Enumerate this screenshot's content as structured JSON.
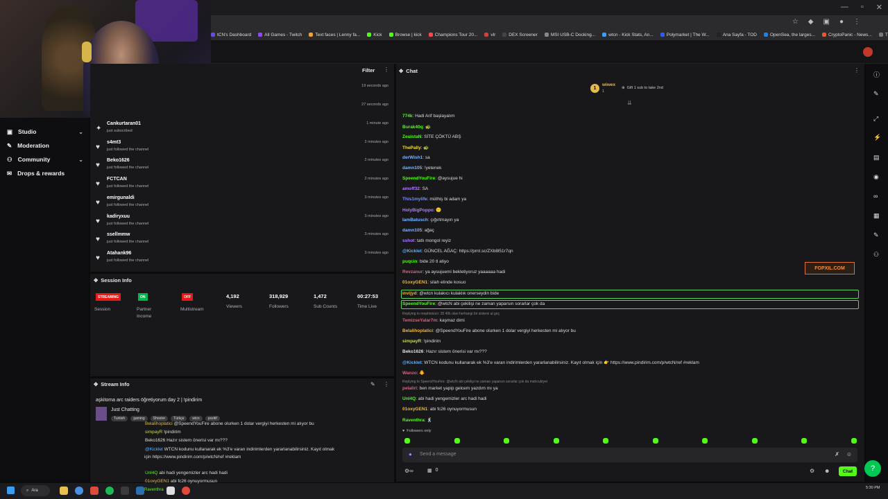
{
  "window": {
    "min": "—",
    "max": "▫",
    "close": "✕"
  },
  "bookmarks": [
    {
      "label": "tCN's Dashboard",
      "color": "#6b4ce0"
    },
    {
      "label": "All Games - Twitch",
      "color": "#9146ff"
    },
    {
      "label": "Text faces | Lenny fa...",
      "color": "#f0a030"
    },
    {
      "label": "Kick",
      "color": "#53fc18"
    },
    {
      "label": "Browse | kick",
      "color": "#53fc18"
    },
    {
      "label": "Champions Tour 20...",
      "color": "#ff4655"
    },
    {
      "label": "vlr",
      "color": "#d04040"
    },
    {
      "label": "DEX Screener",
      "color": "#444"
    },
    {
      "label": "MSI USB-C Docking...",
      "color": "#888"
    },
    {
      "label": "wtcn - Kick Stats, An...",
      "color": "#3aa0ff"
    },
    {
      "label": "Polymarket | The W...",
      "color": "#2f5bff"
    },
    {
      "label": "Ana Sayfa - TOD",
      "color": "#222"
    },
    {
      "label": "OpenSea, the larges...",
      "color": "#2081e2"
    },
    {
      "label": "CryptoPanic - News...",
      "color": "#e65a2c"
    },
    {
      "label": "Tüm Yer İşaretleri",
      "color": "#777"
    }
  ],
  "sidebar": {
    "items": [
      {
        "label": "Studio",
        "icon": "video-icon",
        "chev": "⌄"
      },
      {
        "label": "Moderation",
        "icon": "wrench-icon",
        "chev": ""
      },
      {
        "label": "Community",
        "icon": "people-icon",
        "chev": "⌄"
      },
      {
        "label": "Drops & rewards",
        "icon": "gift-icon",
        "chev": ""
      }
    ]
  },
  "activity": {
    "filter_label": "Filter",
    "menu": "⋮",
    "top_times": [
      "19 seconds ago",
      "27 seconds ago"
    ],
    "rows": [
      {
        "name": "Cankurtaran01",
        "sub": "just subscribed",
        "time": "1 minute ago",
        "icon": "star-icon"
      },
      {
        "name": "s4mt3",
        "sub": "just followed the channel",
        "time": "2 minutes ago",
        "icon": "heart-icon"
      },
      {
        "name": "Beko1626",
        "sub": "just followed the channel",
        "time": "2 minutes ago",
        "icon": "heart-icon"
      },
      {
        "name": "FCTCAN",
        "sub": "just followed the channel",
        "time": "2 minutes ago",
        "icon": "heart-icon"
      },
      {
        "name": "emirgunaldi",
        "sub": "just followed the channel",
        "time": "3 minutes ago",
        "icon": "heart-icon"
      },
      {
        "name": "kadiryxuu",
        "sub": "just followed the channel",
        "time": "3 minutes ago",
        "icon": "heart-icon"
      },
      {
        "name": "ssellmmw",
        "sub": "just followed the channel",
        "time": "3 minutes ago",
        "icon": "heart-icon"
      },
      {
        "name": "Atahank96",
        "sub": "just followed the channel",
        "time": "3 minutes ago",
        "icon": "heart-icon"
      }
    ]
  },
  "session": {
    "title": "Session Info",
    "tags": [
      {
        "badge": "STREAMING",
        "label": "Session",
        "color": "#e91916"
      },
      {
        "badge": "ON",
        "label": "Partner\nIncome",
        "color": "#00b94d"
      },
      {
        "badge": "OFF",
        "label": "Multistream",
        "color": "#e91916"
      }
    ],
    "stats": [
      {
        "value": "4,192",
        "label": "Viewers"
      },
      {
        "value": "318,929",
        "label": "Followers"
      },
      {
        "value": "1,472",
        "label": "Sub Counts"
      },
      {
        "value": "00:27:53",
        "label": "Time Live"
      }
    ]
  },
  "stream_info": {
    "title": "Stream Info",
    "edit": "✎",
    "menu": "⋮",
    "stream_title": "aşkitoma arc raiders öğretiyorum day 2 | !pindirim",
    "category": "Just Chatting",
    "tags": [
      "Turkish",
      "gaming",
      "Shooter",
      "Türkçe",
      "wtcn",
      "pozitif"
    ],
    "overlay_lines": [
      {
        "user": "Belalihoplatici",
        "color": "#e6b94a",
        "text": "@SpeendYouFire abone olurken 1 dolar vergiyi herkesten mi alıyor bu"
      },
      {
        "user": "simpayR",
        "color": "#c8d850",
        "text": "!pindirim"
      },
      {
        "user": "Beko1626",
        "color": "#e0e0e0",
        "text": "Hazır sistem önerisi var mı???"
      },
      {
        "user": "@Kicklet",
        "color": "#5ab3ff",
        "text": "WTCN kodunu kullanarak ek %3'e varan indirimlerden yararlanabilirsiniz. Kayıt olmak"
      },
      {
        "user": "için",
        "color": "#ddd",
        "text": "https://www.pindirim.com/p/wtcN/ref #reklam"
      },
      {
        "user": "Unl4Q",
        "color": "#53fc18",
        "text": "abi hadi yengemizler arc hadi hadi"
      },
      {
        "user": "01oxyGEN1",
        "color": "#e6b94a",
        "text": "abi fc26 oynuyormusun"
      }
    ]
  },
  "chat": {
    "title": "Chat",
    "menu": "⋮",
    "pinned_user": "wiwex",
    "pinned_count": "1",
    "pinned_badge": "1",
    "gift_text": "Gift 1 sub to take 2nd",
    "lines": [
      {
        "user": "774k",
        "color": "#53fc18",
        "text": "Hadi Arif başlayalım"
      },
      {
        "user": "Burak40q",
        "color": "#53fc18",
        "text": "🐢"
      },
      {
        "user": "ZeuistaN",
        "color": "#53fc18",
        "text": "SİTE ÇÖKTÜ ABŞ"
      },
      {
        "user": "ThePally",
        "color": "#f0e030",
        "text": "🐢"
      },
      {
        "user": "derWish1",
        "color": "#7ab6ff",
        "text": "sa"
      },
      {
        "user": "damn105",
        "color": "#7ab6ff",
        "text": "!yetenek"
      },
      {
        "user": "SpeendYouFire",
        "color": "#53fc18",
        "text": "@aysujue hi"
      },
      {
        "user": "amoff32",
        "color": "#b07cff",
        "text": "SA"
      },
      {
        "user": "This1mylife",
        "color": "#7a90ff",
        "text": "müthiş bi adam ya"
      },
      {
        "user": "HolyBigPoppo",
        "color": "#b07cff",
        "text": "🙂"
      },
      {
        "user": "IamBatusch",
        "color": "#7ab6ff",
        "text": "çığırtmayın ya"
      },
      {
        "user": "damn105",
        "color": "#7ab6ff",
        "text": "ağaç"
      },
      {
        "user": "sshot",
        "color": "#b07cff",
        "text": "tatlı mongol reyiz"
      },
      {
        "user": "@Kicklet",
        "color": "#5ab3ff",
        "text": "GÜNCEL AĞAÇ: https://prnt.sc/ZXb8l51r7qn"
      },
      {
        "user": "puqcin",
        "color": "#53fc18",
        "text": "bide 20 tl atiyo"
      },
      {
        "user": "Revzanur",
        "color": "#e06080",
        "text": "ya aysujuemi bekletiyoruz yaaaaaa hadi"
      },
      {
        "user": "01oxyGEN1",
        "color": "#e6b94a",
        "text": "silah elinde kosuo"
      },
      {
        "user": "invijyd",
        "color": "#e6b94a",
        "text": "@wtcn kulakıcı kulaklık onerseydin bide"
      },
      {
        "user": "SpeendYouFire",
        "color": "#53fc18",
        "text": "@wtcN abi çekilişi ne zaman yaparsın sorarlar çok da"
      },
      {
        "user": "TemizseYalar7m",
        "color": "#e06080",
        "text": "kaşmaz dimi"
      },
      {
        "user": "Belalihoplatici",
        "color": "#e6b94a",
        "text": "@SpeendYouFire abone olurken 1 dolar vergiyi herkesten mi alıyor bu"
      },
      {
        "user": "simpayR",
        "color": "#c8d850",
        "text": "!pindirim"
      },
      {
        "user": "Beko1626",
        "color": "#e0e0e0",
        "text": "Hazır sistem önerisi var mı???"
      },
      {
        "user": "@Kicklet",
        "color": "#5ab3ff",
        "text": "WTCN kodunu kullanarak ek %3'e varan indirimlerden yararlanabilirsiniz. Kayıt olmak için 👉 https://www.pindirim.com/p/wtcN/ref #reklam"
      },
      {
        "user": "Wanzo",
        "color": "#e06080",
        "text": "🐥"
      },
      {
        "user": "pelaliri",
        "color": "#e06080",
        "text": "ben market yapip gelcem yazdım mı ya"
      },
      {
        "user": "Unl4Q",
        "color": "#53fc18",
        "text": "abi hadi yengemizler arc hadi hadi"
      },
      {
        "user": "01oxyGEN1",
        "color": "#e6b94a",
        "text": "abi fc26 oynuyormusun"
      },
      {
        "user": "Raventhra",
        "color": "#53fc18",
        "text": "🕺"
      }
    ],
    "reply1": "Replying to mephistocn: 35 40k olan herhangi bir sistemi al geç",
    "reply2": "Replying to SpeendYouFire: @wtcN abi çekilişi ne zaman yaparsın sorarlar çok da mahcubiyet",
    "followers_only": "Followers only",
    "placeholder": "Send a message",
    "send_label": "Chat",
    "count": "0",
    "logo_text": "FOPXIL.COM"
  },
  "taskbar": {
    "search": "Ara",
    "time": "5:30 PM",
    "running_user": "Raventhra"
  }
}
